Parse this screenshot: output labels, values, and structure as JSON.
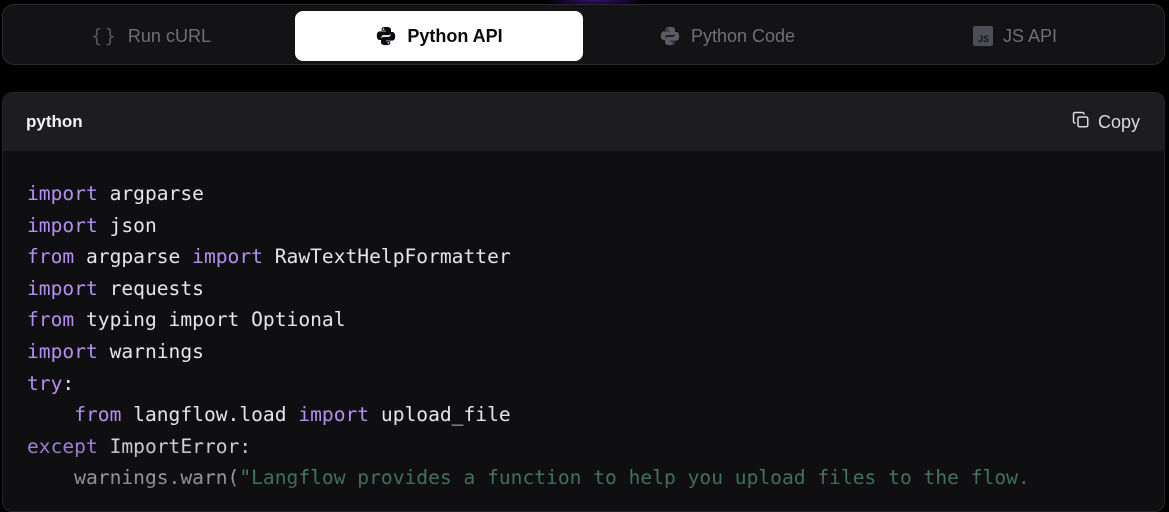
{
  "tabs": [
    {
      "label": "Run cURL",
      "icon": "curly-braces-icon",
      "active": false
    },
    {
      "label": "Python API",
      "icon": "python-icon",
      "active": true
    },
    {
      "label": "Python Code",
      "icon": "python-icon",
      "active": false
    },
    {
      "label": "JS API",
      "icon": "javascript-icon",
      "active": false
    }
  ],
  "code_panel": {
    "language": "python",
    "copy_label": "Copy",
    "copy_icon": "copy-icon",
    "lines": [
      [
        {
          "t": "import",
          "k": "kw"
        },
        {
          "t": " argparse",
          "k": "plain"
        }
      ],
      [
        {
          "t": "import",
          "k": "kw"
        },
        {
          "t": " json",
          "k": "plain"
        }
      ],
      [
        {
          "t": "from",
          "k": "kw"
        },
        {
          "t": " argparse ",
          "k": "plain"
        },
        {
          "t": "import",
          "k": "kw"
        },
        {
          "t": " RawTextHelpFormatter",
          "k": "plain"
        }
      ],
      [
        {
          "t": "import",
          "k": "kw"
        },
        {
          "t": " requests",
          "k": "plain"
        }
      ],
      [
        {
          "t": "from",
          "k": "kw"
        },
        {
          "t": " typing import Optional",
          "k": "plain"
        }
      ],
      [
        {
          "t": "import",
          "k": "kw"
        },
        {
          "t": " warnings",
          "k": "plain"
        }
      ],
      [
        {
          "t": "try",
          "k": "kw"
        },
        {
          "t": ":",
          "k": "plain"
        }
      ],
      [
        {
          "t": "    ",
          "k": "plain"
        },
        {
          "t": "from",
          "k": "kw"
        },
        {
          "t": " langflow.load ",
          "k": "plain"
        },
        {
          "t": "import",
          "k": "kw"
        },
        {
          "t": " upload_file",
          "k": "plain"
        }
      ],
      [
        {
          "t": "except",
          "k": "kw"
        },
        {
          "t": " ImportError:",
          "k": "plain"
        }
      ],
      [
        {
          "t": "    warnings.warn(",
          "k": "plain"
        },
        {
          "t": "\"Langflow provides a function to help you upload files to the flow.",
          "k": "str"
        }
      ]
    ]
  },
  "colors": {
    "keyword": "#b58ff0",
    "string": "#5fae86",
    "plain": "#e6e6ea",
    "active_tab_bg": "#ffffff"
  }
}
